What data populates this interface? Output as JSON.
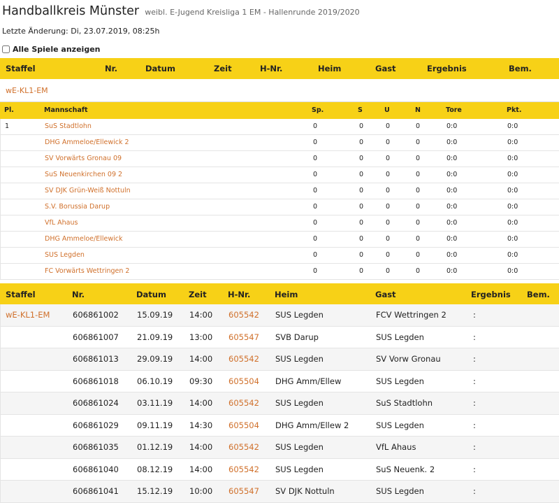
{
  "header": {
    "title": "Handballkreis Münster",
    "subtitle": "weibl. E-Jugend Kreisliga 1 EM - Hallenrunde 2019/2020",
    "last_change": "Letzte Änderung: Di, 23.07.2019, 08:25h",
    "show_all_label": "Alle Spiele anzeigen"
  },
  "top_header": {
    "staffel": "Staffel",
    "nr": "Nr.",
    "datum": "Datum",
    "zeit": "Zeit",
    "hnr": "H-Nr.",
    "heim": "Heim",
    "gast": "Gast",
    "ergebnis": "Ergebnis",
    "bem": "Bem."
  },
  "group_label": "wE-KL1-EM",
  "standings": {
    "headers": {
      "pl": "Pl.",
      "team": "Mannschaft",
      "sp": "Sp.",
      "s": "S",
      "u": "U",
      "n": "N",
      "tore": "Tore",
      "pkt": "Pkt."
    },
    "rows": [
      {
        "pl": "1",
        "team": "SuS Stadtlohn",
        "sp": "0",
        "s": "0",
        "u": "0",
        "n": "0",
        "tore": "0:0",
        "pkt": "0:0"
      },
      {
        "pl": "",
        "team": "DHG Ammeloe/Ellewick 2",
        "sp": "0",
        "s": "0",
        "u": "0",
        "n": "0",
        "tore": "0:0",
        "pkt": "0:0"
      },
      {
        "pl": "",
        "team": "SV Vorwärts Gronau 09",
        "sp": "0",
        "s": "0",
        "u": "0",
        "n": "0",
        "tore": "0:0",
        "pkt": "0:0"
      },
      {
        "pl": "",
        "team": "SuS Neuenkirchen 09 2",
        "sp": "0",
        "s": "0",
        "u": "0",
        "n": "0",
        "tore": "0:0",
        "pkt": "0:0"
      },
      {
        "pl": "",
        "team": "SV DJK Grün-Weiß Nottuln",
        "sp": "0",
        "s": "0",
        "u": "0",
        "n": "0",
        "tore": "0:0",
        "pkt": "0:0"
      },
      {
        "pl": "",
        "team": "S.V. Borussia Darup",
        "sp": "0",
        "s": "0",
        "u": "0",
        "n": "0",
        "tore": "0:0",
        "pkt": "0:0"
      },
      {
        "pl": "",
        "team": "VfL Ahaus",
        "sp": "0",
        "s": "0",
        "u": "0",
        "n": "0",
        "tore": "0:0",
        "pkt": "0:0"
      },
      {
        "pl": "",
        "team": "DHG Ammeloe/Ellewick",
        "sp": "0",
        "s": "0",
        "u": "0",
        "n": "0",
        "tore": "0:0",
        "pkt": "0:0"
      },
      {
        "pl": "",
        "team": "SUS Legden",
        "sp": "0",
        "s": "0",
        "u": "0",
        "n": "0",
        "tore": "0:0",
        "pkt": "0:0"
      },
      {
        "pl": "",
        "team": "FC Vorwärts Wettringen 2",
        "sp": "0",
        "s": "0",
        "u": "0",
        "n": "0",
        "tore": "0:0",
        "pkt": "0:0"
      }
    ]
  },
  "games": {
    "headers": {
      "staffel": "Staffel",
      "nr": "Nr.",
      "datum": "Datum",
      "zeit": "Zeit",
      "hnr": "H-Nr.",
      "heim": "Heim",
      "gast": "Gast",
      "ergebnis": "Ergebnis",
      "bem": "Bem."
    },
    "rows": [
      {
        "staffel": "wE-KL1-EM",
        "nr": "606861002",
        "datum": "15.09.19",
        "zeit": "14:00",
        "hnr": "605542",
        "heim": "SUS Legden",
        "gast": "FCV Wettringen 2",
        "ergebnis": ":",
        "bem": ""
      },
      {
        "staffel": "",
        "nr": "606861007",
        "datum": "21.09.19",
        "zeit": "13:00",
        "hnr": "605547",
        "heim": "SVB Darup",
        "gast": "SUS Legden",
        "ergebnis": ":",
        "bem": ""
      },
      {
        "staffel": "",
        "nr": "606861013",
        "datum": "29.09.19",
        "zeit": "14:00",
        "hnr": "605542",
        "heim": "SUS Legden",
        "gast": "SV Vorw Gronau",
        "ergebnis": ":",
        "bem": ""
      },
      {
        "staffel": "",
        "nr": "606861018",
        "datum": "06.10.19",
        "zeit": "09:30",
        "hnr": "605504",
        "heim": "DHG Amm/Ellew",
        "gast": "SUS Legden",
        "ergebnis": ":",
        "bem": ""
      },
      {
        "staffel": "",
        "nr": "606861024",
        "datum": "03.11.19",
        "zeit": "14:00",
        "hnr": "605542",
        "heim": "SUS Legden",
        "gast": "SuS Stadtlohn",
        "ergebnis": ":",
        "bem": ""
      },
      {
        "staffel": "",
        "nr": "606861029",
        "datum": "09.11.19",
        "zeit": "14:30",
        "hnr": "605504",
        "heim": "DHG Amm/Ellew 2",
        "gast": "SUS Legden",
        "ergebnis": ":",
        "bem": ""
      },
      {
        "staffel": "",
        "nr": "606861035",
        "datum": "01.12.19",
        "zeit": "14:00",
        "hnr": "605542",
        "heim": "SUS Legden",
        "gast": "VfL Ahaus",
        "ergebnis": ":",
        "bem": ""
      },
      {
        "staffel": "",
        "nr": "606861040",
        "datum": "08.12.19",
        "zeit": "14:00",
        "hnr": "605542",
        "heim": "SUS Legden",
        "gast": "SuS Neuenk. 2",
        "ergebnis": ":",
        "bem": ""
      },
      {
        "staffel": "",
        "nr": "606861041",
        "datum": "15.12.19",
        "zeit": "10:00",
        "hnr": "605547",
        "heim": "SV DJK Nottuln",
        "gast": "SUS Legden",
        "ergebnis": ":",
        "bem": ""
      }
    ]
  },
  "colors": {
    "header_bar": "#f7d117",
    "link": "#d0702b"
  }
}
